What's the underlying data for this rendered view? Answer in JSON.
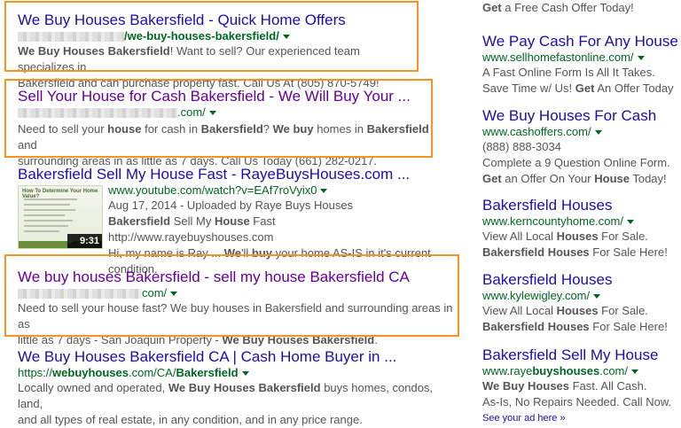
{
  "results": [
    {
      "title": "We Buy Houses Bakersfield - Quick Home Offers",
      "url_prefix": "",
      "url_bold": "/we-buy-houses-bakersfield/",
      "snippet_lines": [
        [
          "<b>We Buy Houses Bakersfield</b>! Want to sell? Our experienced team specializes in"
        ],
        [
          "Bakersfield and can purchase property fast. Call Us At (805) 870-5749!"
        ]
      ]
    },
    {
      "title": "Sell Your House for Cash Bakersfield - We Will Buy Your ...",
      "url_suffix": ".com/",
      "snippet_lines": [
        [
          "Need to sell your <b>house</b> for cash in <b>Bakersfield</b>? <b>We buy</b> homes in <b>Bakersfield</b> and"
        ],
        [
          "surrounding areas in as little as 7 days. Call Us Today (661) 282-0217."
        ]
      ]
    },
    {
      "title": "Bakersfield Sell My House Fast - RayeBuysHouses.com ...",
      "url": "www.youtube.com/watch?v=EAf7roVyix0",
      "meta": "Aug 17, 2014 - Uploaded by Raye Buys Houses",
      "snippet_lines": [
        [
          "<b>Bakersfield</b> Sell My <b>House</b> Fast http://www.rayebuyshouses.com"
        ],
        [
          "Hi, my name is Ray ... <b>We</b>'ll <b>buy</b> your home AS-IS in it's current"
        ],
        [
          "condition."
        ]
      ],
      "thumb_title": "How To Determine Your Home Value?",
      "duration": "9:31"
    },
    {
      "title": "We buy houses Bakersfield - sell my house Bakersfield CA",
      "url_suffix": "com/",
      "snippet_lines": [
        [
          "Need to sell your house fast? We buy houses in Bakersfield and surrounding areas in as"
        ],
        [
          "little as 7 days - San Joaquin Property - <b>We Buy Houses Bakersfield</b>."
        ]
      ]
    },
    {
      "title": "We Buy Houses Bakersfield CA | Cash Home Buyer in ...",
      "url_html": "https://<b>webuyhouses</b>.com/CA/<b>Bakersfield</b>",
      "snippet_lines": [
        [
          "Locally owned and operated, <b>We Buy Houses Bakersfield</b> buys homes, condos, land,"
        ],
        [
          "and all types of real estate, in any condition, and in any price range."
        ]
      ]
    }
  ],
  "ads": [
    {
      "title": "",
      "url_html": "",
      "lines": [
        "<b>Get</b> a Free Cash Offer Today!"
      ]
    },
    {
      "title": "We Pay Cash For Any House",
      "url_html": "www.sellhomefastonline.com/",
      "lines": [
        "A Fast Online Form Is All It Takes.",
        "Save Time w/ Us! <b>Get</b> An Offer Today"
      ]
    },
    {
      "title": "We Buy Houses For Cash",
      "url_html": "www.cashoffers.com/",
      "lines": [
        "(888) 888-3034",
        "Complete a 9 Question Online Form.",
        "<b>Get</b> an Offer On Your <b>House</b> Today!"
      ]
    },
    {
      "title": "Bakersfield Houses",
      "url_html": "www.kerncountyhome.com/",
      "lines": [
        "View All Local <b>Houses</b> For Sale.",
        "<b>Bakersfield Houses</b> For Sale Here!"
      ]
    },
    {
      "title": "Bakersfield Houses",
      "url_html": "www.kylewigley.com/",
      "lines": [
        "View All Local <b>Houses</b> For Sale.",
        "<b>Bakersfield Houses</b> For Sale Here!"
      ]
    },
    {
      "title": "Bakersfield Sell My House",
      "url_html": "www.raye<b>buyshouses</b>.com/",
      "lines": [
        "<b>We Buy Houses</b> Fast. All Cash.",
        "As-Is, No Repairs Needed. Call Now."
      ]
    }
  ],
  "see_ad": "See your ad here »",
  "colors": {
    "highlight": "#f7931e",
    "link": "#1a0dab",
    "visited": "#660099",
    "url": "#006621"
  }
}
